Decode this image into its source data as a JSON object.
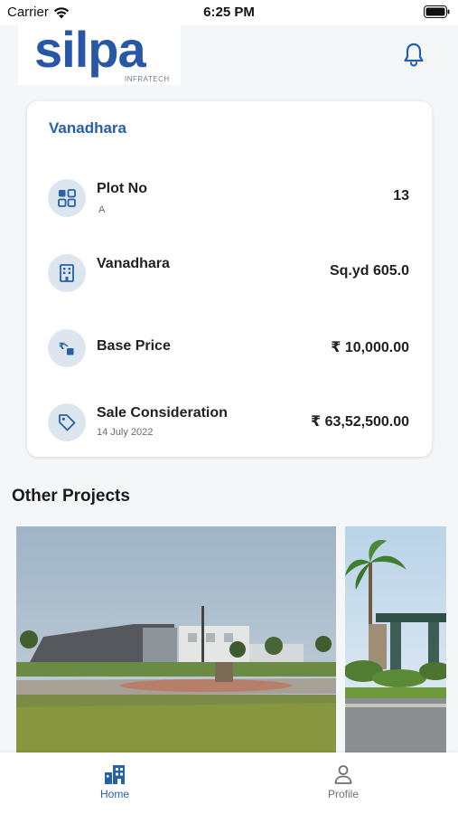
{
  "status_bar": {
    "carrier": "Carrier",
    "time": "6:25 PM"
  },
  "header": {
    "logo_word": "silpa",
    "logo_sub": "INFRATECH"
  },
  "property": {
    "title": "Vanadhara",
    "rows": [
      {
        "icon": "grid-icon",
        "label": "Plot No",
        "sub": "A",
        "value": "13"
      },
      {
        "icon": "building-icon",
        "label": "Vanadhara",
        "sub": "",
        "value": "Sq.yd 605.0"
      },
      {
        "icon": "rupee-transfer-icon",
        "label": "Base Price",
        "sub": "",
        "value": "₹ 10,000.00"
      },
      {
        "icon": "price-tag-icon",
        "label": "Sale Consideration",
        "sub": "14 July 2022",
        "value": "₹ 63,52,500.00"
      }
    ]
  },
  "other_projects": {
    "title": "Other Projects"
  },
  "bottom_nav": {
    "items": [
      {
        "icon": "home-building-icon",
        "label": "Home",
        "active": true
      },
      {
        "icon": "profile-icon",
        "label": "Profile",
        "active": false
      }
    ]
  },
  "colors": {
    "accent": "#2560a8",
    "icon_bg": "#dde5ef",
    "background": "#f5f6f8",
    "inactive": "#6b6f78"
  }
}
